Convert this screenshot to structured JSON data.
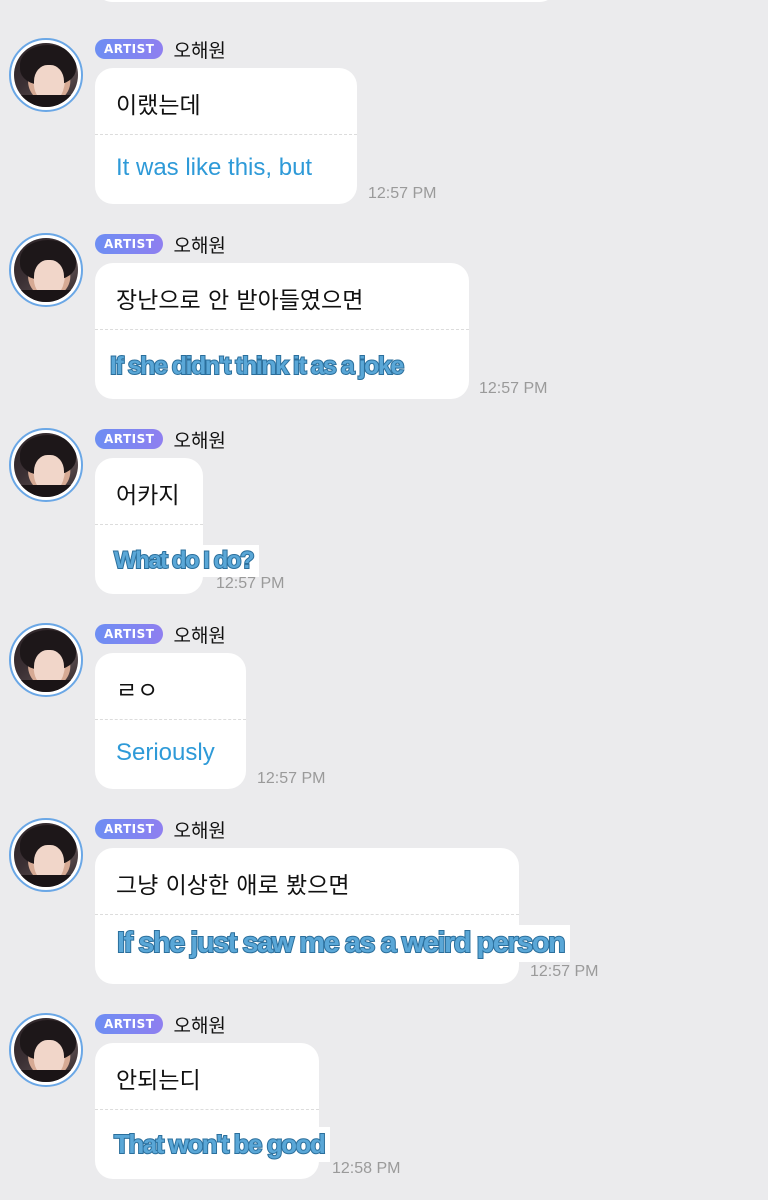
{
  "sender": {
    "badge": "ARTIST",
    "name": "오해원",
    "avatar_icon": "profile-photo"
  },
  "messages": [
    {
      "korean": "이랬는데",
      "translation": "It was like this, but",
      "time": "12:57 PM"
    },
    {
      "korean": "장난으로 안 받아들였으면",
      "translation": "If she didn't think it as a joke",
      "time": "12:57 PM"
    },
    {
      "korean": "어카지",
      "translation": "What do I do?",
      "time": "12:57 PM"
    },
    {
      "korean": "ㄹㅇ",
      "translation": "Seriously",
      "time": "12:57 PM"
    },
    {
      "korean": "그냥 이상한 애로 봤으면",
      "translation": "If she just saw me as a weird person",
      "time": "12:57 PM"
    },
    {
      "korean": "안되는디",
      "translation": "That won't be good",
      "time": "12:58 PM"
    }
  ],
  "colors": {
    "background": "#ebebed",
    "bubble": "#ffffff",
    "translation_text": "#2e9ad8",
    "badge_gradient_start": "#6d8ef3",
    "badge_gradient_end": "#8f7ff0",
    "avatar_ring": "#6aa7e6",
    "timestamp": "#9a9a9a"
  }
}
